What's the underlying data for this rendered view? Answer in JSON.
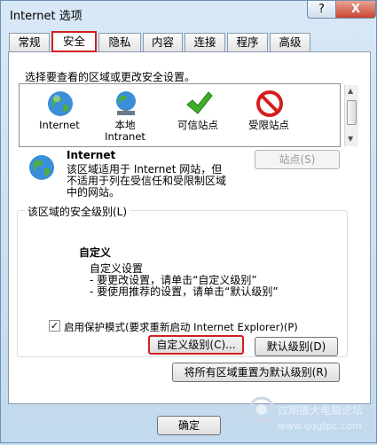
{
  "window": {
    "title": "Internet 选项",
    "help_glyph": "?",
    "close_glyph": "X"
  },
  "tabs": [
    {
      "label": "常规",
      "active": false
    },
    {
      "label": "安全",
      "active": true
    },
    {
      "label": "隐私",
      "active": false
    },
    {
      "label": "内容",
      "active": false
    },
    {
      "label": "连接",
      "active": false
    },
    {
      "label": "程序",
      "active": false
    },
    {
      "label": "高级",
      "active": false
    }
  ],
  "security": {
    "select_zone_label": "选择要查看的区域或更改安全设置。",
    "zones": [
      {
        "name": "Internet",
        "icon": "globe-icon"
      },
      {
        "name": "本地\nIntranet",
        "icon": "intranet-globe-icon"
      },
      {
        "name": "可信站点",
        "icon": "checkmark-icon"
      },
      {
        "name": "受限站点",
        "icon": "restricted-icon"
      }
    ],
    "selected_zone": {
      "title": "Internet",
      "description": "该区域适用于 Internet 网站，但\n不适用于列在受信任和受限制区域\n中的网站。",
      "sites_button": "站点(S)"
    },
    "level_group_title": "该区域的安全级别(L)",
    "level": {
      "name": "自定义",
      "line1": "自定义设置",
      "line2": "- 要更改设置，请单击“自定义级别”",
      "line3": "- 要使用推荐的设置，请单击“默认级别”"
    },
    "protected_mode_label": "启用保护模式(要求重新启动 Internet Explorer)(P)",
    "protected_mode_checked": true,
    "custom_level_button": "自定义级别(C)...",
    "default_level_button": "默认级别(D)",
    "reset_all_button": "将所有区域重置为默认级别(R)"
  },
  "footer": {
    "ok_button": "确定"
  },
  "watermark": {
    "line1": "过期撒大电脑论坛",
    "line2": "www.gqgtpc.com"
  },
  "colors": {
    "highlight_red": "#d12020",
    "dialog_bg": "#c9dff0"
  }
}
